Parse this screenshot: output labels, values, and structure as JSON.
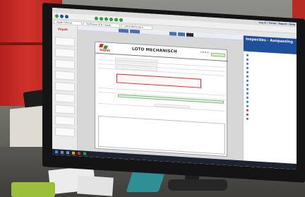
{
  "browser": {
    "tabs": [
      "Vopak Intranet",
      "Stolthaven ATD / Vopak",
      "LOTO Mechanisch"
    ],
    "top_links": [
      "Log in",
      "Portal",
      "Report",
      "Help"
    ]
  },
  "sidebar": {
    "logo": "Vopak",
    "items": [
      "",
      "",
      "",
      "",
      "",
      "",
      "",
      "",
      ""
    ]
  },
  "document": {
    "brand": "Vopak",
    "title": "LOTO MECHANISCH",
    "header_field": "LOTO nr.",
    "rows": [
      "",
      "",
      "",
      "",
      "",
      ""
    ],
    "highlight_text": "",
    "footer_labels": [
      "",
      "",
      ""
    ]
  },
  "right_panel": {
    "title": "Inspecties - Aanpassing",
    "subtitle": "",
    "items": [
      "",
      "",
      "",
      "",
      "",
      "",
      "",
      "",
      "",
      "",
      "",
      "",
      "",
      "",
      "",
      ""
    ]
  },
  "taskbar": {
    "time": "",
    "date": ""
  },
  "colors": {
    "brand_red": "#d52a26",
    "header_blue": "#1f4e9a",
    "highlight_red": "#d4322c",
    "status_green": "#8cc06f"
  }
}
